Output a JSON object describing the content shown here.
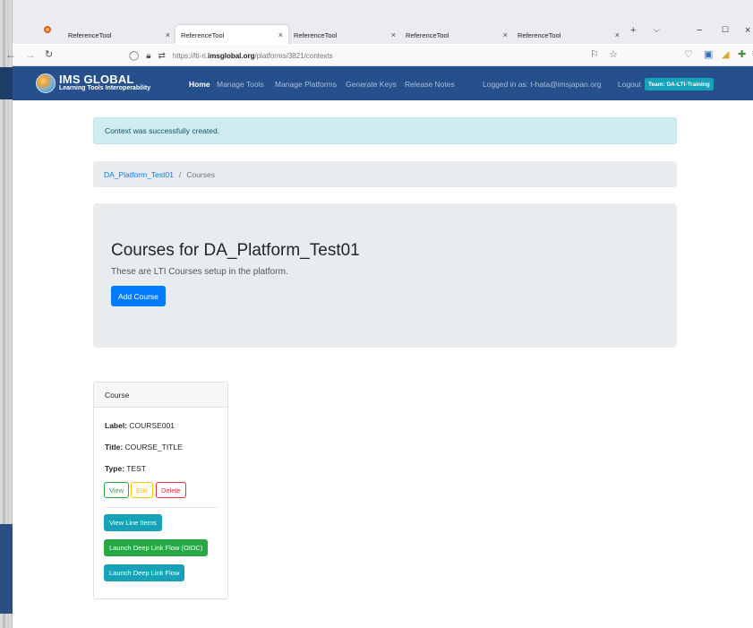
{
  "browser": {
    "tabs": [
      {
        "label": "ReferenceTool"
      },
      {
        "label": "ReferenceTool"
      },
      {
        "label": "ReferenceTool"
      },
      {
        "label": "ReferenceTool"
      },
      {
        "label": "ReferenceTool"
      }
    ],
    "url_prefix": "https://lti-ri.",
    "url_domain": "imsglobal.org",
    "url_path": "/platforms/3821/contexts"
  },
  "site": {
    "logo_title": "IMS GLOBAL",
    "logo_subtitle": "Learning Tools Interoperability",
    "nav": [
      "Home",
      "Manage Tools",
      "Manage Platforms",
      "Generate Keys",
      "Release Notes"
    ],
    "logged_in": "Logged in as: t-hata@imsjapan.org",
    "logout": "Logout",
    "team": "Team: DA-LTI-Training"
  },
  "alert": "Context was successfully created.",
  "breadcrumb": {
    "platform": "DA_Platform_Test01",
    "separator": "/",
    "current": "Courses"
  },
  "jumbotron": {
    "title": "Courses for DA_Platform_Test01",
    "subtitle": "These are LTI Courses setup in the platform.",
    "add_button": "Add Course"
  },
  "course_card": {
    "header": "Course",
    "label_key": "Label:",
    "label_value": "COURSE001",
    "title_key": "Title:",
    "title_value": "COURSE_TITLE",
    "type_key": "Type:",
    "type_value": "TEST",
    "view": "View",
    "edit": "Edit",
    "delete": "Delete",
    "view_line_items": "View Line Items",
    "launch_oidc": "Launch Deep Link Flow (OIDC)",
    "launch": "Launch Deep Link Flow"
  },
  "colors": {
    "navbar": "#25508b",
    "primary": "#007bff",
    "info": "#17a2b8",
    "success": "#28a745",
    "warning": "#ffc107",
    "danger": "#dc3545"
  }
}
